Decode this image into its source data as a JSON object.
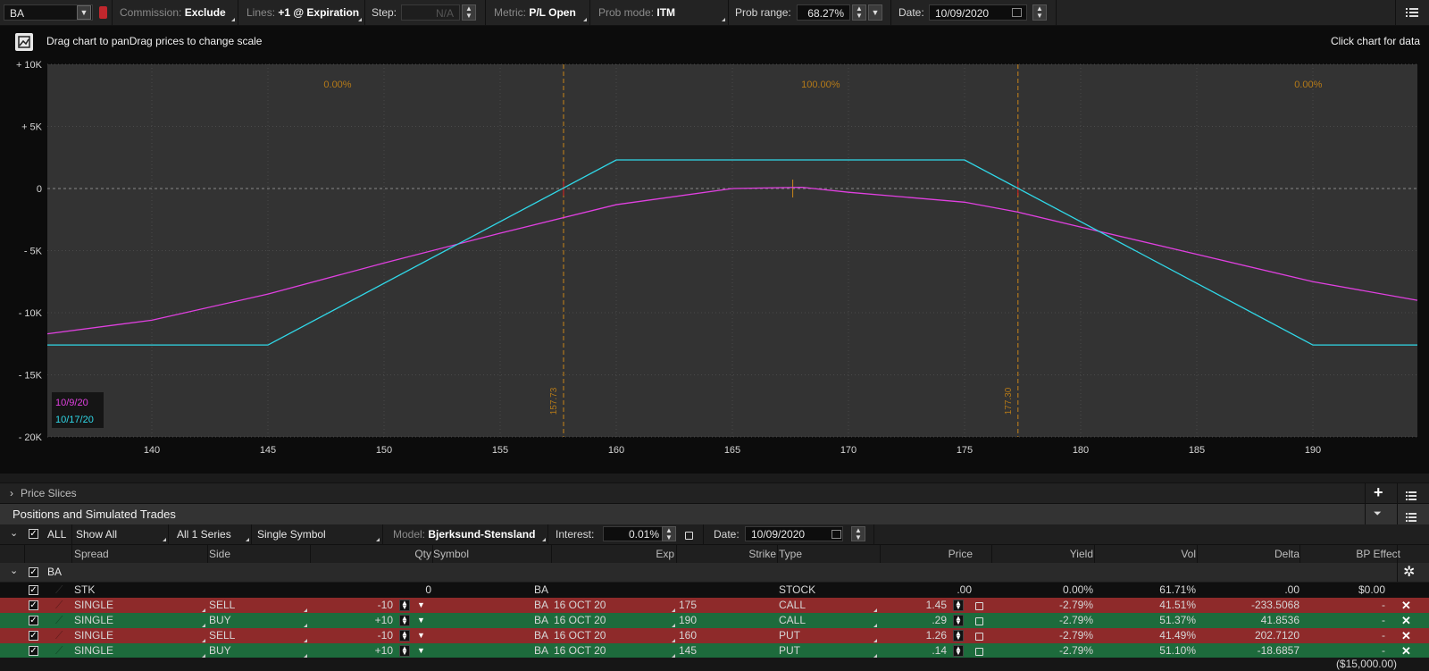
{
  "toolbar": {
    "symbol": "BA",
    "commission_label": "Commission:",
    "commission_value": "Exclude",
    "lines_label": "Lines:",
    "lines_value": "+1 @ Expiration",
    "step_label": "Step:",
    "step_value": "N/A",
    "metric_label": "Metric:",
    "metric_value": "P/L Open",
    "prob_mode_label": "Prob mode:",
    "prob_mode_value": "ITM",
    "prob_range_label": "Prob range:",
    "prob_range_value": "68.27%",
    "date_label": "Date:",
    "date_value": "10/09/2020"
  },
  "chart_header": {
    "hint": "Drag chart to panDrag prices to change scale",
    "right_hint": "Click chart for data"
  },
  "chart_data": {
    "type": "line",
    "x_range": [
      135.5,
      194.5
    ],
    "y_range": [
      -20000,
      10000
    ],
    "x_ticks": [
      "140",
      "145",
      "150",
      "155",
      "160",
      "165",
      "170",
      "175",
      "180",
      "185",
      "190"
    ],
    "x_tick_values": [
      140,
      145,
      150,
      155,
      160,
      165,
      170,
      175,
      180,
      185,
      190
    ],
    "y_ticks": [
      "+ 10K",
      "+ 5K",
      "0",
      "- 5K",
      "- 10K",
      "- 15K",
      "- 20K"
    ],
    "y_tick_values": [
      10000,
      5000,
      0,
      -5000,
      -10000,
      -15000,
      -20000
    ],
    "prob_labels": [
      "0.00%",
      "100.00%",
      "0.00%"
    ],
    "prob_label_x": [
      148,
      168.8,
      189.8
    ],
    "breakevens": [
      {
        "label": "157.73",
        "x": 157.73
      },
      {
        "label": "177.30",
        "x": 177.3
      }
    ],
    "current_price": 167.6,
    "legend": [
      {
        "name": "10/9/20",
        "color": "#e040e0"
      },
      {
        "name": "10/17/20",
        "color": "#30d8e8"
      }
    ],
    "series": [
      {
        "name": "10/9/20",
        "color": "#e040e0",
        "points": [
          [
            135.5,
            -11700
          ],
          [
            140,
            -10600
          ],
          [
            145,
            -8500
          ],
          [
            150,
            -6000
          ],
          [
            155,
            -3600
          ],
          [
            160,
            -1300
          ],
          [
            165,
            0
          ],
          [
            168,
            100
          ],
          [
            170,
            -300
          ],
          [
            175,
            -1100
          ],
          [
            177.3,
            -1900
          ],
          [
            180,
            -3100
          ],
          [
            185,
            -5300
          ],
          [
            190,
            -7500
          ],
          [
            194.5,
            -9000
          ]
        ]
      },
      {
        "name": "10/17/20",
        "color": "#30d8e8",
        "points": [
          [
            135.5,
            -12600
          ],
          [
            145,
            -12600
          ],
          [
            160,
            2300
          ],
          [
            175,
            2300
          ],
          [
            190,
            -12600
          ],
          [
            194.5,
            -12600
          ]
        ]
      }
    ]
  },
  "price_slices": {
    "label": "Price Slices"
  },
  "positions": {
    "title": "Positions and Simulated Trades",
    "filter_all": "ALL",
    "show_all": "Show All",
    "series": "All 1 Series",
    "single_symbol": "Single Symbol",
    "model_label": "Model:",
    "model_value": "Bjerksund-Stensland",
    "interest_label": "Interest:",
    "interest_value": "0.01%",
    "date_label": "Date:",
    "date_value": "10/09/2020",
    "columns": [
      "Spread",
      "Side",
      "Qty",
      "Symbol",
      "Exp",
      "Strike",
      "Type",
      "Price",
      "Yield",
      "Vol",
      "Delta",
      "BP Effect"
    ],
    "group_name": "BA",
    "stock_row": {
      "spread": "STK",
      "qty": "0",
      "symbol": "BA",
      "type": "STOCK",
      "price": ".00",
      "yield": "0.00%",
      "vol": "61.71%",
      "delta": ".00",
      "bp": "$0.00"
    },
    "rows": [
      {
        "spread": "SINGLE",
        "side": "SELL",
        "qty": "-10",
        "symbol": "BA",
        "exp": "16 OCT 20",
        "strike": "175",
        "type": "CALL",
        "price": "1.45",
        "yield": "-2.79%",
        "vol": "41.51%",
        "delta": "-233.5068",
        "bp": "-",
        "color": "#8e2a2a"
      },
      {
        "spread": "SINGLE",
        "side": "BUY",
        "qty": "+10",
        "symbol": "BA",
        "exp": "16 OCT 20",
        "strike": "190",
        "type": "CALL",
        "price": ".29",
        "yield": "-2.79%",
        "vol": "51.37%",
        "delta": "41.8536",
        "bp": "-",
        "color": "#1d6b3c"
      },
      {
        "spread": "SINGLE",
        "side": "SELL",
        "qty": "-10",
        "symbol": "BA",
        "exp": "16 OCT 20",
        "strike": "160",
        "type": "PUT",
        "price": "1.26",
        "yield": "-2.79%",
        "vol": "41.49%",
        "delta": "202.7120",
        "bp": "-",
        "color": "#8e2a2a"
      },
      {
        "spread": "SINGLE",
        "side": "BUY",
        "qty": "+10",
        "symbol": "BA",
        "exp": "16 OCT 20",
        "strike": "145",
        "type": "PUT",
        "price": ".14",
        "yield": "-2.79%",
        "vol": "51.10%",
        "delta": "-18.6857",
        "bp": "-",
        "color": "#1d6b3c"
      }
    ],
    "total_bp": "($15,000.00)"
  }
}
